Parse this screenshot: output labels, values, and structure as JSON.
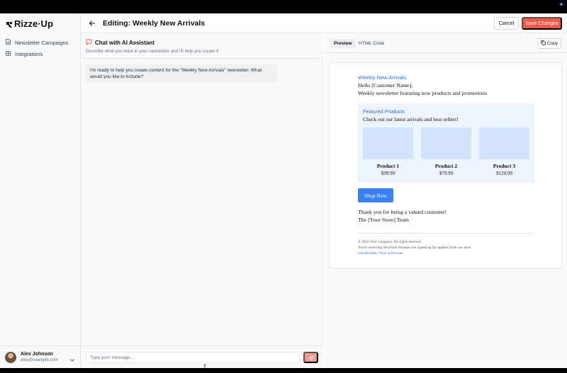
{
  "app": {
    "brand": "Rizze·Up"
  },
  "sidebar": {
    "items": [
      {
        "label": "Newsletter Campaigns",
        "icon": "document-icon"
      },
      {
        "label": "Integrations",
        "icon": "grid-icon"
      }
    ],
    "user": {
      "name": "Alex Johnson",
      "email": "alex@example.com"
    }
  },
  "header": {
    "title": "Editing: Weekly New Arrivals",
    "cancel_label": "Cancel",
    "save_label": "Save Changes"
  },
  "chat": {
    "title": "Chat with AI Assistant",
    "subtitle": "Describe what you want in your newsletter and I'll help you create it",
    "messages": [
      {
        "role": "assistant",
        "text": "I'm ready to help you create content for the \"Weekly New Arrivals\" newsletter. What would you like to include?"
      }
    ],
    "input_placeholder": "Type your message...",
    "input_value": ""
  },
  "preview": {
    "tabs": [
      {
        "label": "Preview",
        "active": true
      },
      {
        "label": "HTML Code",
        "active": false
      }
    ],
    "copy_label": "Copy",
    "email": {
      "heading": "Weekly New Arrivals",
      "greeting": "Hello [Customer Name],",
      "intro": "Weekly newsletter featuring new products and promotions",
      "featured_title": "Featured Products",
      "featured_subtitle": "Check out our latest arrivals and best sellers!",
      "products": [
        {
          "name": "Product 1",
          "price": "$99.99"
        },
        {
          "name": "Product 2",
          "price": "$79.99"
        },
        {
          "name": "Product 3",
          "price": "$129.99"
        }
      ],
      "cta_label": "Shop Now",
      "thanks": "Thank you for being a valued customer!",
      "signature": "The [Your Store] Team",
      "copyright": "© 2024 Your Company. All rights reserved.",
      "reason": "You're receiving this email because you signed up for updates from our store.",
      "unsubscribe_label": "Unsubscribe",
      "link_separator": "|",
      "view_in_browser_label": "View in browser"
    }
  },
  "colors": {
    "accent": "#f0594a",
    "link_blue": "#2f6fd4",
    "cta_blue": "#3b82f6",
    "featured_bg": "#eef4fd",
    "product_image_bg": "#d3e3fb"
  }
}
